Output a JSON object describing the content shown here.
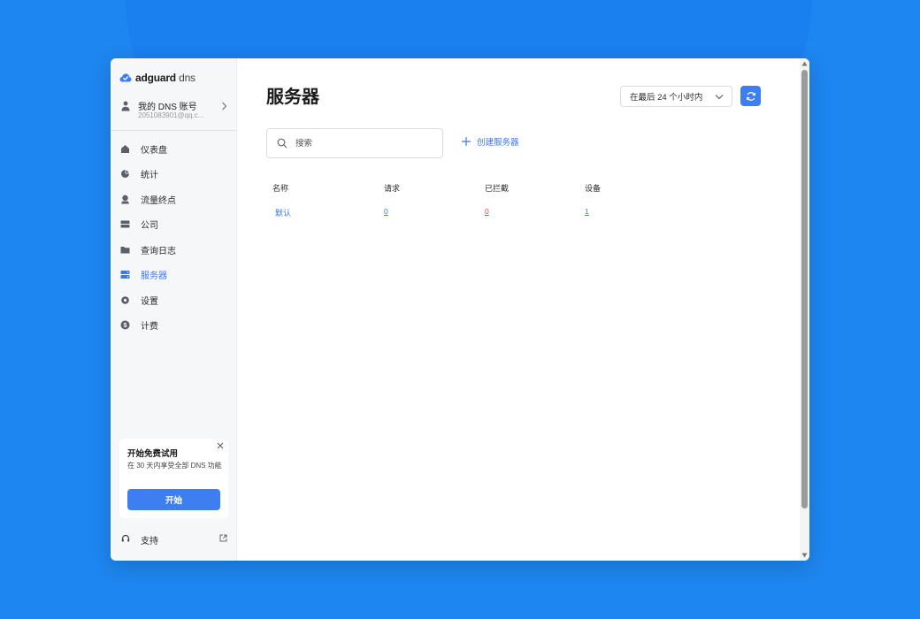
{
  "app": {
    "logo_bold": "adguard",
    "logo_light": "dns"
  },
  "account": {
    "title": "我的 DNS 账号",
    "email": "2051083901@qq.c..."
  },
  "sidebar": {
    "items": [
      {
        "label": "仪表盘",
        "icon": "dashboard-icon"
      },
      {
        "label": "统计",
        "icon": "pie-chart-icon"
      },
      {
        "label": "流量终点",
        "icon": "map-pin-icon"
      },
      {
        "label": "公司",
        "icon": "company-icon"
      },
      {
        "label": "查询日志",
        "icon": "folder-icon"
      },
      {
        "label": "服务器",
        "icon": "server-icon",
        "active": true
      },
      {
        "label": "设置",
        "icon": "gear-icon"
      },
      {
        "label": "计费",
        "icon": "dollar-icon"
      }
    ]
  },
  "trial": {
    "title": "开始免费试用",
    "description": "在 30 天内享受全部 DNS 功能",
    "button": "开始"
  },
  "support": {
    "label": "支持"
  },
  "main": {
    "title": "服务器",
    "period": "在最后 24 个小时内",
    "search_placeholder": "搜索",
    "create_label": "创建服务器",
    "table": {
      "headers": [
        "名称",
        "请求",
        "已拦截",
        "设备"
      ],
      "rows": [
        {
          "name": "默认",
          "requests": "0",
          "blocked": "0",
          "devices": "1"
        }
      ]
    }
  },
  "colors": {
    "accent": "#3d7ff0",
    "background": "#1e86f0",
    "blocked": "#e0443f"
  }
}
